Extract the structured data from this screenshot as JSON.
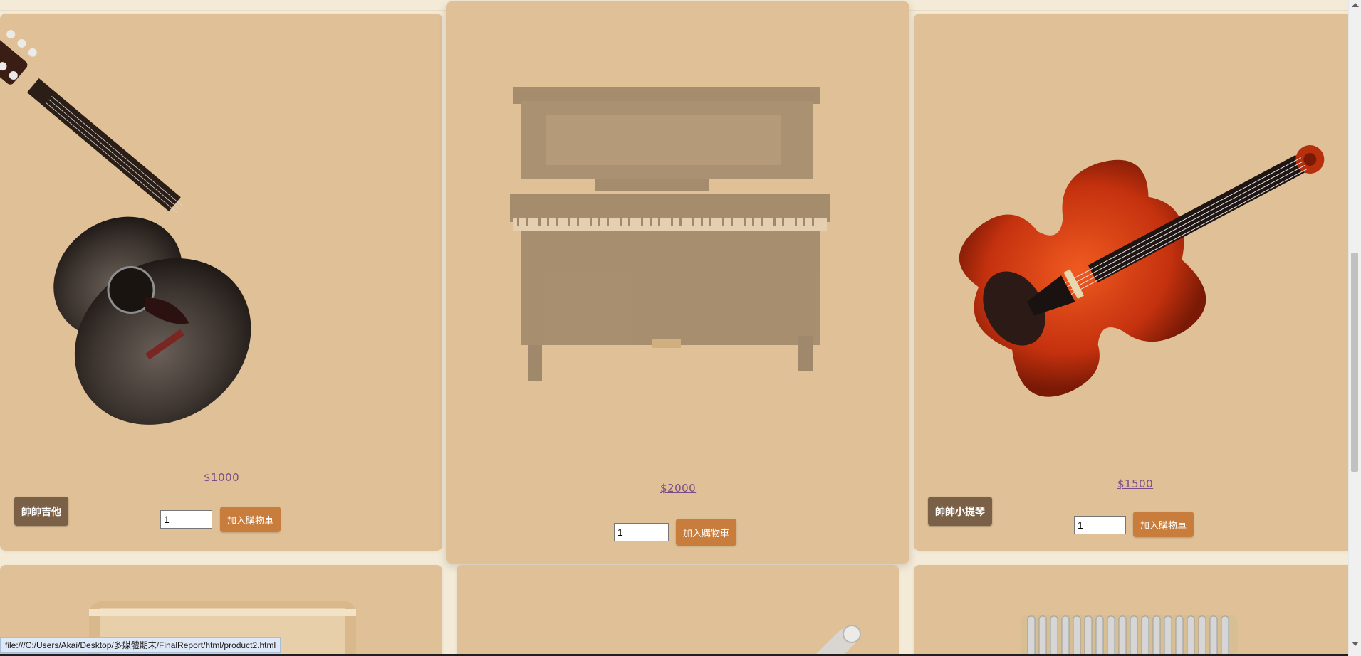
{
  "products": [
    {
      "name_label": "帥帥吉他",
      "price": "$1000",
      "qty": "1",
      "add_label": "加入購物車",
      "image": "acoustic-guitar"
    },
    {
      "name_label": "",
      "price": "$2000",
      "qty": "1",
      "add_label": "加入購物車",
      "image": "upright-piano"
    },
    {
      "name_label": "帥帥小提琴",
      "price": "$1500",
      "qty": "1",
      "add_label": "加入購物車",
      "image": "violin"
    }
  ],
  "lower_row": [
    {
      "image": "cajon"
    },
    {
      "image": "trumpet"
    },
    {
      "image": "kalimba"
    }
  ],
  "status_bar": {
    "url": "file:///C:/Users/Akai/Desktop/多媒體期末/FinalReport/html/product2.html"
  },
  "colors": {
    "card_bg": "#e0c197",
    "page_bg": "#f4ead8",
    "name_button": "#7a6046",
    "add_button": "#c97d3c",
    "price_link": "#7a4c86"
  }
}
